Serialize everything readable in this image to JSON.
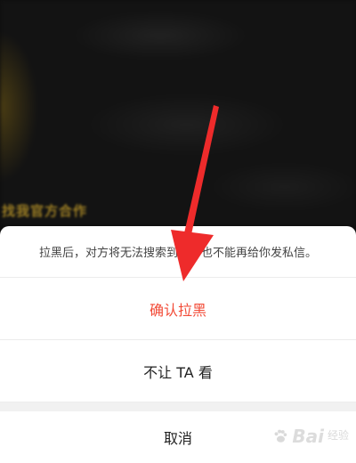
{
  "background": {
    "caption": "找我官方合作"
  },
  "action_sheet": {
    "message": "拉黑后，对方将无法搜索到你，也不能再给你发私信。",
    "confirm_label": "确认拉黑",
    "hide_label": "不让 TA 看",
    "cancel_label": "取消"
  },
  "colors": {
    "confirm": "#f24a36",
    "arrow": "#ee2b2b",
    "caption": "#c9a12a"
  },
  "watermark": {
    "brand": "Bai",
    "sub": "经验"
  }
}
